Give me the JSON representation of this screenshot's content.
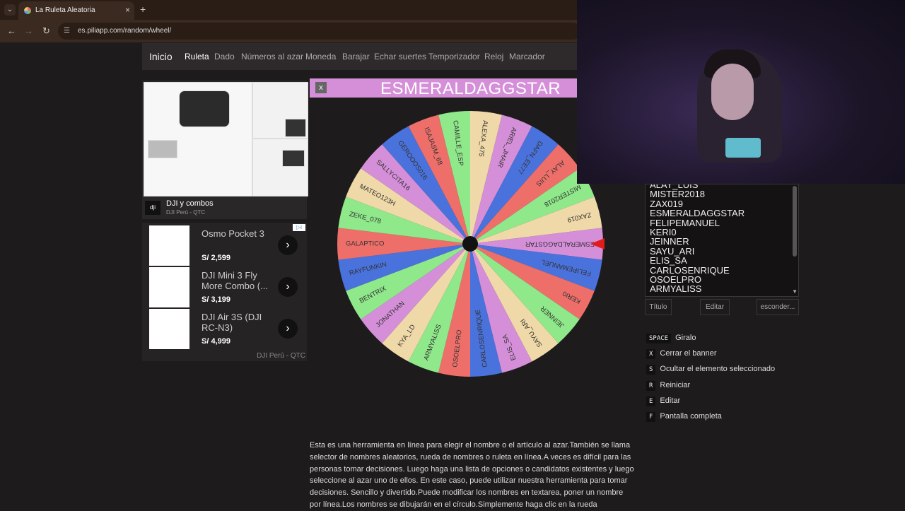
{
  "browser": {
    "tab_title": "La Ruleta Aleatoria",
    "url": "es.piliapp.com/random/wheel/",
    "tab_close": "×",
    "new_tab": "+"
  },
  "site_nav": {
    "home": "Inicio",
    "items": [
      "Ruleta",
      "Dado",
      "Números al azar",
      "Moneda",
      "Barajar",
      "Echar suertes",
      "Temporizador",
      "Reloj",
      "Marcador"
    ]
  },
  "ads": {
    "banner": {
      "title": "DJI y combos",
      "subtitle": "DJI Perú - QTC",
      "logo": "dji"
    },
    "products": [
      {
        "name": "Osmo Pocket 3",
        "price": "S/ 2,599"
      },
      {
        "name": "DJI Mini 3 Fly More Combo (...",
        "price": "S/ 3,199"
      },
      {
        "name": "DJI Air 3S (DJI RC-N3)",
        "price": "S/ 4,999"
      }
    ],
    "footer": "DJI Perú - QTC"
  },
  "winner": {
    "close_label": "x",
    "name": "ESMERALDAGGSTAR",
    "color": "#d58fd9"
  },
  "wheel": {
    "segments": [
      {
        "label": "CAMILLE_ESP",
        "color": "#8fe88a"
      },
      {
        "label": "ALEXA_475",
        "color": "#f0d9a8"
      },
      {
        "label": "ARIEL_JHAIR",
        "color": "#d58fd9"
      },
      {
        "label": "DAFN_EE77",
        "color": "#4a72dc"
      },
      {
        "label": "ALAY_LUIS",
        "color": "#ee6f6a"
      },
      {
        "label": "MISTER2018",
        "color": "#8fe88a"
      },
      {
        "label": "ZAX019",
        "color": "#f0d9a8"
      },
      {
        "label": "ESMERALDAGGSTAR",
        "color": "#d58fd9"
      },
      {
        "label": "FELIPEMANUEL",
        "color": "#4a72dc"
      },
      {
        "label": "KERI0",
        "color": "#ee6f6a"
      },
      {
        "label": "JEINNER",
        "color": "#8fe88a"
      },
      {
        "label": "SAYU_ARI",
        "color": "#f0d9a8"
      },
      {
        "label": "ELIS_SA",
        "color": "#d58fd9"
      },
      {
        "label": "CARLOSENRIQUE",
        "color": "#4a72dc"
      },
      {
        "label": "OSOELPRO",
        "color": "#ee6f6a"
      },
      {
        "label": "ARMYALISS",
        "color": "#8fe88a"
      },
      {
        "label": "KYA_LD",
        "color": "#f0d9a8"
      },
      {
        "label": "JONATHAN",
        "color": "#d58fd9"
      },
      {
        "label": "BENTRIX",
        "color": "#8fe88a"
      },
      {
        "label": "RAYFUNKIN",
        "color": "#4a72dc"
      },
      {
        "label": "GALAPTICO",
        "color": "#ee6f6a"
      },
      {
        "label": "ZEKE_078",
        "color": "#8fe88a"
      },
      {
        "label": "MATEO123H",
        "color": "#f0d9a8"
      },
      {
        "label": "SALLYCITA16",
        "color": "#d58fd9"
      },
      {
        "label": "GEROOOS016",
        "color": "#4a72dc"
      },
      {
        "label": "ISAJASM_68",
        "color": "#ee6f6a"
      }
    ]
  },
  "names_list": {
    "lines": [
      "ALAY_LUIS",
      "MISTER2018",
      "ZAX019",
      "ESMERALDAGGSTAR",
      "FELIPEMANUEL",
      "KERI0",
      "JEINNER",
      "SAYU_ARI",
      "ELIS_SA",
      "CARLOSENRIQUE",
      "OSOELPRO",
      "ARMYALISS"
    ]
  },
  "controls": {
    "title_btn": "Título",
    "edit_btn": "Editar",
    "hide_btn": "esconder..."
  },
  "shortcuts": [
    {
      "key": "SPACE",
      "label": "Giralo"
    },
    {
      "key": "X",
      "label": "Cerrar el banner"
    },
    {
      "key": "S",
      "label": "Ocultar el elemento seleccionado"
    },
    {
      "key": "R",
      "label": "Reiniciar"
    },
    {
      "key": "E",
      "label": "Editar"
    },
    {
      "key": "F",
      "label": "Pantalla completa"
    }
  ],
  "description": "Esta es una herramienta en línea para elegir el nombre o el artículo al azar.También se llama selector de nombres aleatorios, rueda de nombres o ruleta en línea.A veces es difícil para las personas tomar decisiones. Luego haga una lista de opciones o candidatos existentes y luego seleccione al azar uno de ellos. En este caso, puede utilizar nuestra herramienta para tomar decisiones. Sencillo y divertido.Puede modificar los nombres en textarea, poner un nombre por línea.Los nombres se dibujarán en el círculo.Simplemente haga clic en la rueda"
}
